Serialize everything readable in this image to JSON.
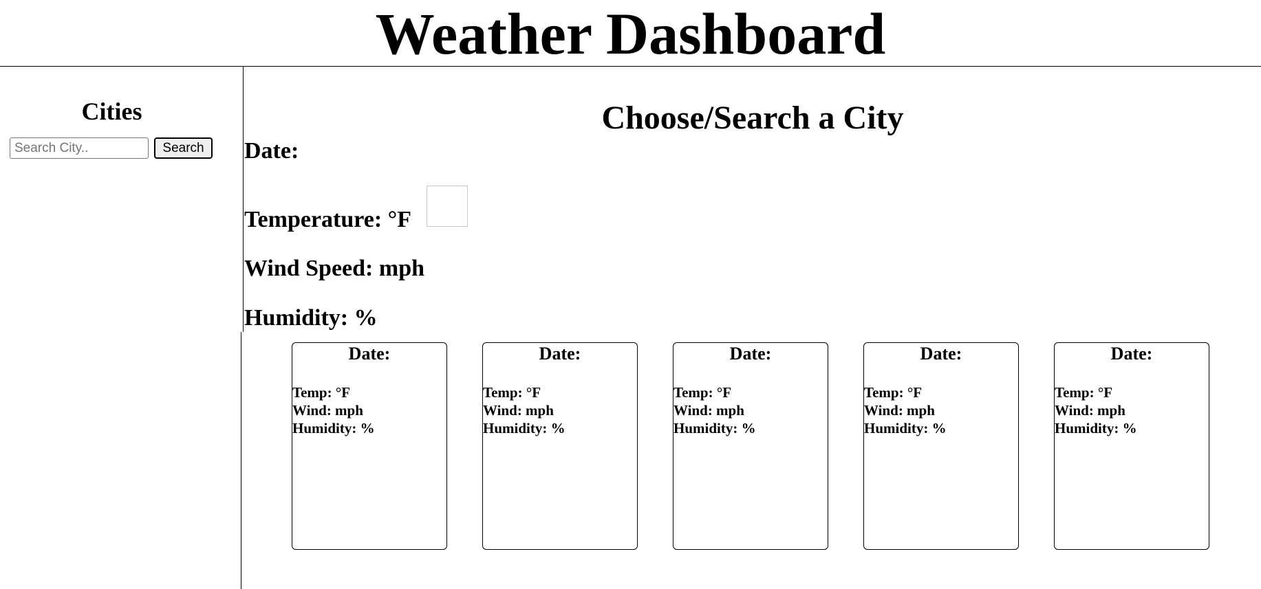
{
  "header": {
    "title": "Weather Dashboard"
  },
  "sidebar": {
    "title": "Cities",
    "search": {
      "placeholder": "Search City..",
      "value": ""
    },
    "search_button_label": "Search"
  },
  "main": {
    "title": "Choose/Search a City",
    "current": {
      "date": "Date:",
      "temperature": "Temperature: °F",
      "wind": "Wind Speed: mph",
      "humidity": "Humidity: %"
    },
    "forecast": [
      {
        "date": "Date:",
        "temp": "Temp: °F",
        "wind": "Wind: mph",
        "humidity": "Humidity: %"
      },
      {
        "date": "Date:",
        "temp": "Temp: °F",
        "wind": "Wind: mph",
        "humidity": "Humidity: %"
      },
      {
        "date": "Date:",
        "temp": "Temp: °F",
        "wind": "Wind: mph",
        "humidity": "Humidity: %"
      },
      {
        "date": "Date:",
        "temp": "Temp: °F",
        "wind": "Wind: mph",
        "humidity": "Humidity: %"
      },
      {
        "date": "Date:",
        "temp": "Temp: °F",
        "wind": "Wind: mph",
        "humidity": "Humidity: %"
      }
    ]
  }
}
